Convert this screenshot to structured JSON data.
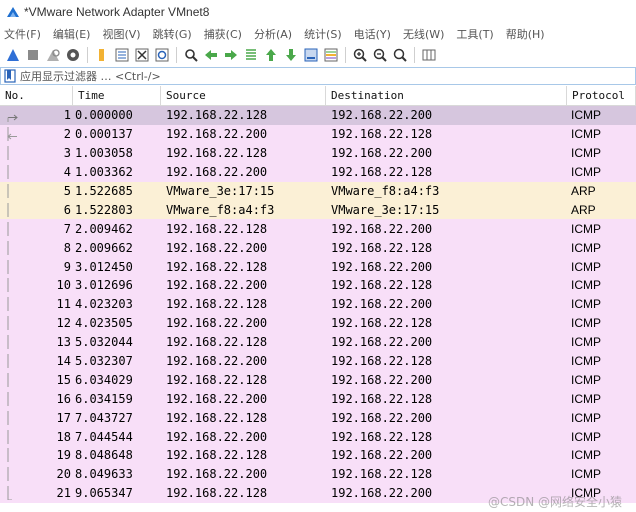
{
  "window": {
    "title": "*VMware Network Adapter VMnet8"
  },
  "menu": [
    "文件(F)",
    "编辑(E)",
    "视图(V)",
    "跳转(G)",
    "捕获(C)",
    "分析(A)",
    "统计(S)",
    "电话(Y)",
    "无线(W)",
    "工具(T)",
    "帮助(H)"
  ],
  "toolbar": {
    "icons": [
      "shark-fin-start-icon",
      "stop-square-icon",
      "restart-fin-icon",
      "capture-options-gear-icon",
      "open-folder-icon",
      "save-file-icon",
      "close-file-icon",
      "reload-icon",
      "find-packet-magnifier-icon",
      "go-back-arrow-icon",
      "go-forward-arrow-icon",
      "go-to-packet-icon",
      "first-packet-icon",
      "last-packet-icon",
      "auto-scroll-icon",
      "colorize-lines-icon",
      "zoom-in-icon",
      "zoom-out-icon",
      "normal-size-icon",
      "resize-columns-icon"
    ]
  },
  "filter": {
    "placeholder": "应用显示过滤器 … <Ctrl-/>"
  },
  "columns": {
    "no": "No.",
    "time": "Time",
    "source": "Source",
    "destination": "Destination",
    "protocol": "Protocol"
  },
  "colors": {
    "icmp": "#f8dff8",
    "arp": "#fbf0d6",
    "selected": "#d6c6de"
  },
  "packets": [
    {
      "no": "1",
      "time": "0.000000",
      "src": "192.168.22.128",
      "dst": "192.168.22.200",
      "proto": "ICMP"
    },
    {
      "no": "2",
      "time": "0.000137",
      "src": "192.168.22.200",
      "dst": "192.168.22.128",
      "proto": "ICMP"
    },
    {
      "no": "3",
      "time": "1.003058",
      "src": "192.168.22.128",
      "dst": "192.168.22.200",
      "proto": "ICMP"
    },
    {
      "no": "4",
      "time": "1.003362",
      "src": "192.168.22.200",
      "dst": "192.168.22.128",
      "proto": "ICMP"
    },
    {
      "no": "5",
      "time": "1.522685",
      "src": "VMware_3e:17:15",
      "dst": "VMware_f8:a4:f3",
      "proto": "ARP"
    },
    {
      "no": "6",
      "time": "1.522803",
      "src": "VMware_f8:a4:f3",
      "dst": "VMware_3e:17:15",
      "proto": "ARP"
    },
    {
      "no": "7",
      "time": "2.009462",
      "src": "192.168.22.128",
      "dst": "192.168.22.200",
      "proto": "ICMP"
    },
    {
      "no": "8",
      "time": "2.009662",
      "src": "192.168.22.200",
      "dst": "192.168.22.128",
      "proto": "ICMP"
    },
    {
      "no": "9",
      "time": "3.012450",
      "src": "192.168.22.128",
      "dst": "192.168.22.200",
      "proto": "ICMP"
    },
    {
      "no": "10",
      "time": "3.012696",
      "src": "192.168.22.200",
      "dst": "192.168.22.128",
      "proto": "ICMP"
    },
    {
      "no": "11",
      "time": "4.023203",
      "src": "192.168.22.128",
      "dst": "192.168.22.200",
      "proto": "ICMP"
    },
    {
      "no": "12",
      "time": "4.023505",
      "src": "192.168.22.200",
      "dst": "192.168.22.128",
      "proto": "ICMP"
    },
    {
      "no": "13",
      "time": "5.032044",
      "src": "192.168.22.128",
      "dst": "192.168.22.200",
      "proto": "ICMP"
    },
    {
      "no": "14",
      "time": "5.032307",
      "src": "192.168.22.200",
      "dst": "192.168.22.128",
      "proto": "ICMP"
    },
    {
      "no": "15",
      "time": "6.034029",
      "src": "192.168.22.128",
      "dst": "192.168.22.200",
      "proto": "ICMP"
    },
    {
      "no": "16",
      "time": "6.034159",
      "src": "192.168.22.200",
      "dst": "192.168.22.128",
      "proto": "ICMP"
    },
    {
      "no": "17",
      "time": "7.043727",
      "src": "192.168.22.128",
      "dst": "192.168.22.200",
      "proto": "ICMP"
    },
    {
      "no": "18",
      "time": "7.044544",
      "src": "192.168.22.200",
      "dst": "192.168.22.128",
      "proto": "ICMP"
    },
    {
      "no": "19",
      "time": "8.048648",
      "src": "192.168.22.128",
      "dst": "192.168.22.200",
      "proto": "ICMP"
    },
    {
      "no": "20",
      "time": "8.049633",
      "src": "192.168.22.200",
      "dst": "192.168.22.128",
      "proto": "ICMP"
    },
    {
      "no": "21",
      "time": "9.065347",
      "src": "192.168.22.128",
      "dst": "192.168.22.200",
      "proto": "ICMP"
    }
  ],
  "selected_row": 1,
  "watermark": "@CSDN @网络安全小猿"
}
